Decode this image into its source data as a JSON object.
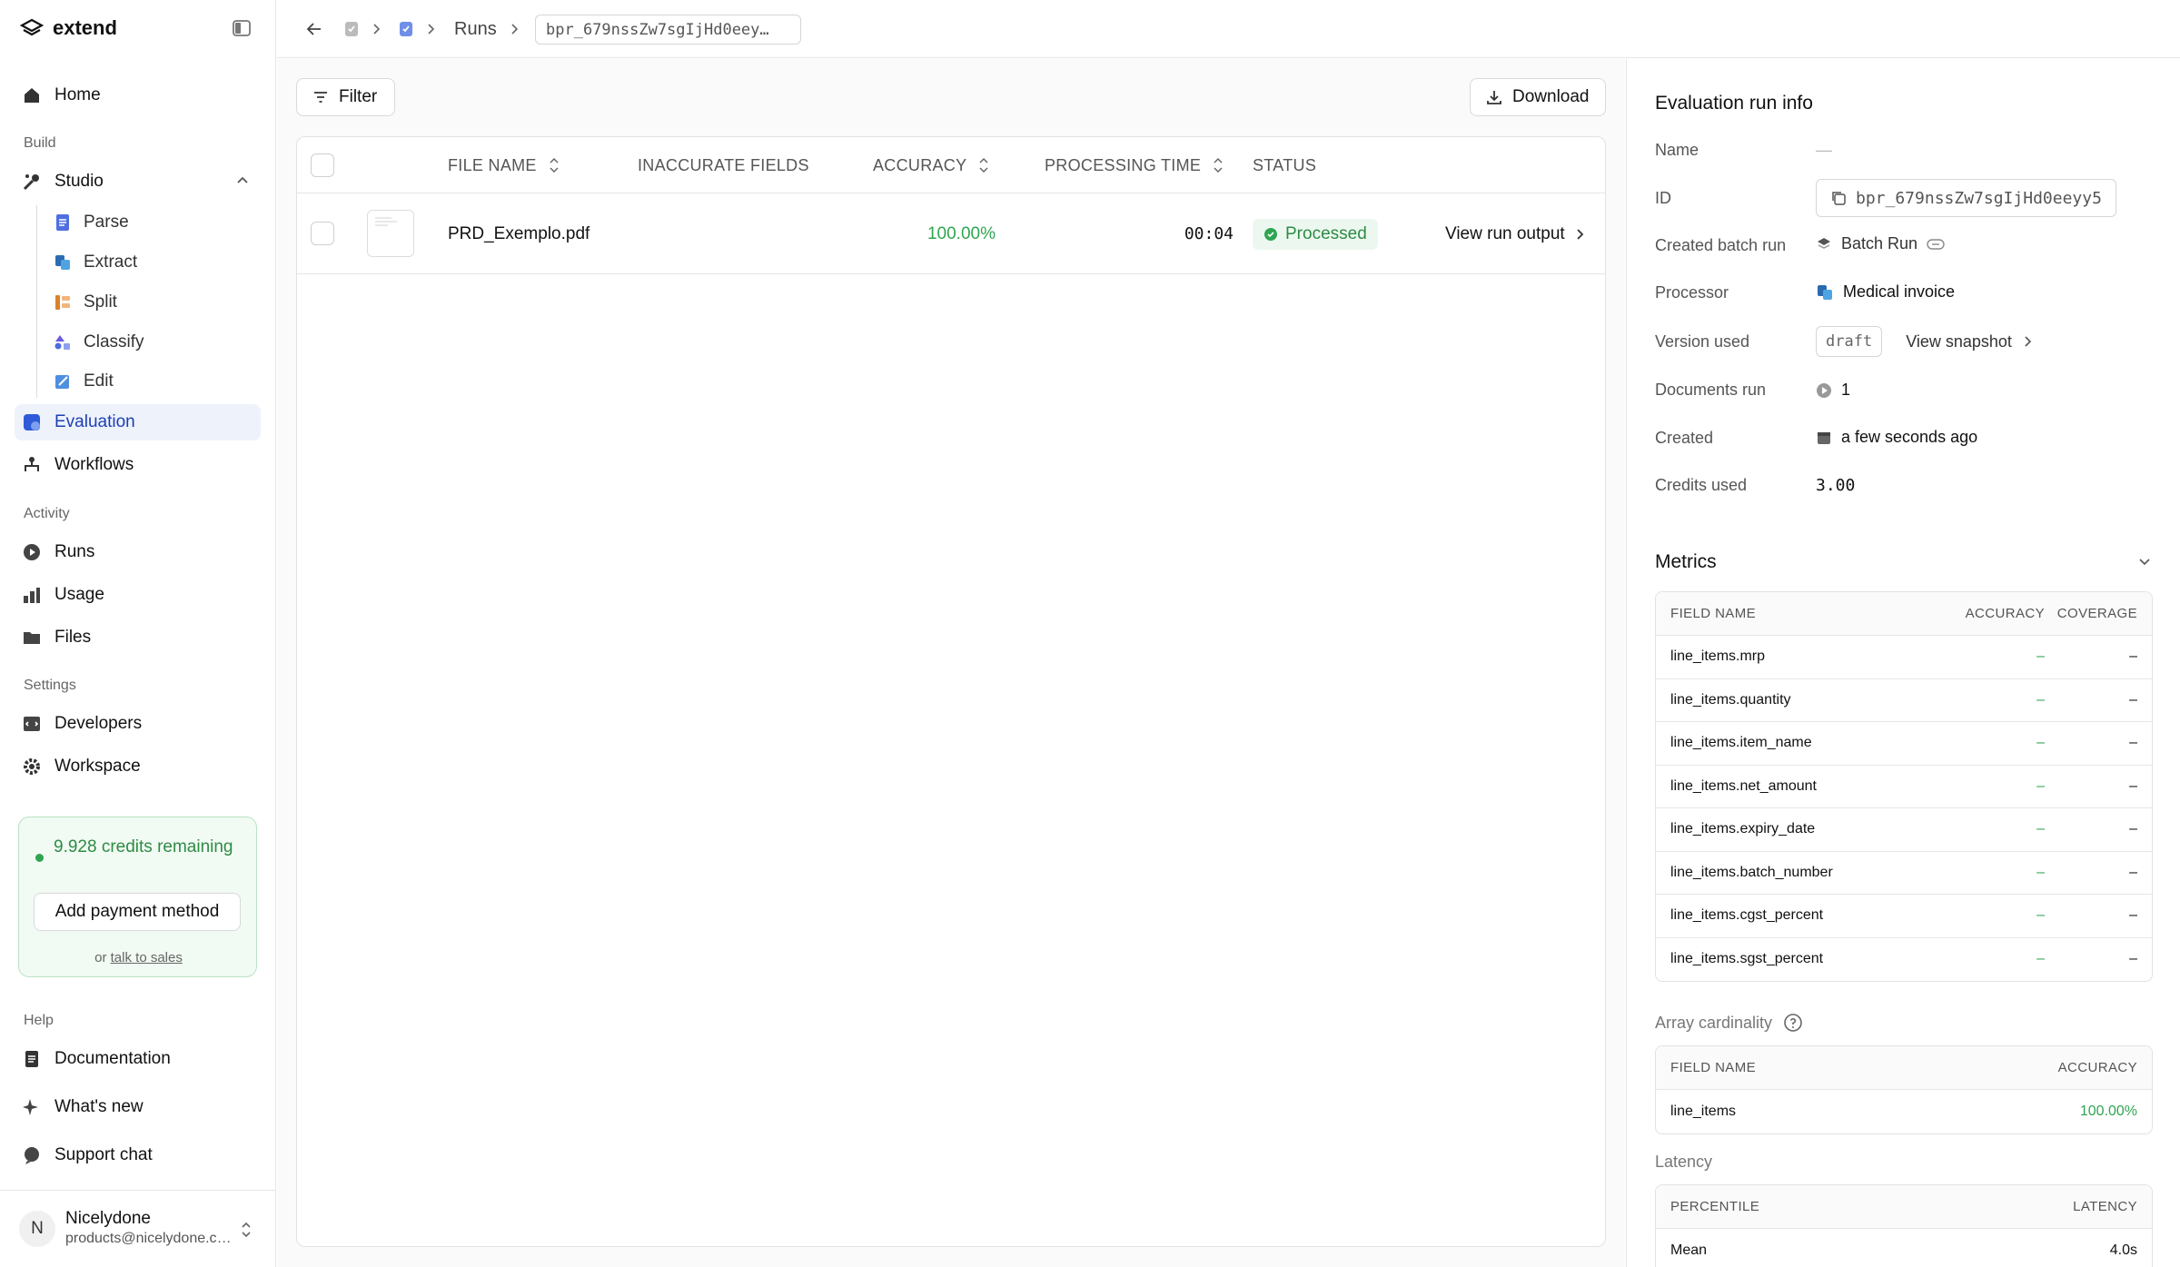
{
  "app": {
    "brand": "extend"
  },
  "sidebar": {
    "home": "Home",
    "build_label": "Build",
    "studio": "Studio",
    "studio_items": [
      "Parse",
      "Extract",
      "Split",
      "Classify",
      "Edit"
    ],
    "evaluation": "Evaluation",
    "workflows": "Workflows",
    "activity_label": "Activity",
    "runs": "Runs",
    "usage": "Usage",
    "files": "Files",
    "settings_label": "Settings",
    "developers": "Developers",
    "workspace": "Workspace",
    "credits_text": "9.928 credits remaining",
    "add_payment": "Add payment method",
    "or": "or",
    "talk_to_sales": "talk to sales",
    "help_label": "Help",
    "documentation": "Documentation",
    "whats_new": "What's new",
    "support_chat": "Support chat",
    "user_initial": "N",
    "user_name": "Nicelydone",
    "user_email": "products@nicelydone.club"
  },
  "breadcrumb": {
    "runs": "Runs",
    "run_id": "bpr_679nssZw7sgIjHd0eey…"
  },
  "toolbar": {
    "filter": "Filter",
    "download": "Download"
  },
  "table": {
    "headers": {
      "file_name": "FILE NAME",
      "inaccurate_fields": "INACCURATE FIELDS",
      "accuracy": "ACCURACY",
      "processing_time": "PROCESSING TIME",
      "status": "STATUS"
    },
    "rows": [
      {
        "file_name": "PRD_Exemplo.pdf",
        "inaccurate_fields": "",
        "accuracy": "100.00%",
        "processing_time": "00:04",
        "status": "Processed",
        "action": "View run output"
      }
    ]
  },
  "panel": {
    "title": "Evaluation run info",
    "labels": {
      "name": "Name",
      "id": "ID",
      "created_batch_run": "Created batch run",
      "processor": "Processor",
      "version_used": "Version used",
      "documents_run": "Documents run",
      "created": "Created",
      "credits_used": "Credits used"
    },
    "values": {
      "name": "—",
      "id": "bpr_679nssZw7sgIjHd0eeyy5",
      "created_batch_run": "Batch Run",
      "processor": "Medical invoice",
      "version": "draft",
      "view_snapshot": "View snapshot",
      "documents_run": "1",
      "created": "a few seconds ago",
      "credits_used": "3.00"
    },
    "metrics": {
      "title": "Metrics",
      "headers": {
        "field_name": "FIELD NAME",
        "accuracy": "ACCURACY",
        "coverage": "COVERAGE"
      },
      "rows": [
        {
          "field": "line_items.mrp",
          "accuracy": "–",
          "coverage": "–"
        },
        {
          "field": "line_items.quantity",
          "accuracy": "–",
          "coverage": "–"
        },
        {
          "field": "line_items.item_name",
          "accuracy": "–",
          "coverage": "–"
        },
        {
          "field": "line_items.net_amount",
          "accuracy": "–",
          "coverage": "–"
        },
        {
          "field": "line_items.expiry_date",
          "accuracy": "–",
          "coverage": "–"
        },
        {
          "field": "line_items.batch_number",
          "accuracy": "–",
          "coverage": "–"
        },
        {
          "field": "line_items.cgst_percent",
          "accuracy": "–",
          "coverage": "–"
        },
        {
          "field": "line_items.sgst_percent",
          "accuracy": "–",
          "coverage": "–"
        }
      ]
    },
    "cardinality": {
      "title": "Array cardinality",
      "headers": {
        "field_name": "FIELD NAME",
        "accuracy": "ACCURACY"
      },
      "rows": [
        {
          "field": "line_items",
          "accuracy": "100.00%"
        }
      ]
    },
    "latency": {
      "title": "Latency",
      "headers": {
        "percentile": "PERCENTILE",
        "latency": "LATENCY"
      },
      "rows": [
        {
          "percentile": "Mean",
          "latency": "4.0s"
        }
      ]
    }
  },
  "colors": {
    "accent": "#1c3fb5",
    "success": "#2fa551",
    "active_bg": "#eef2fb"
  }
}
